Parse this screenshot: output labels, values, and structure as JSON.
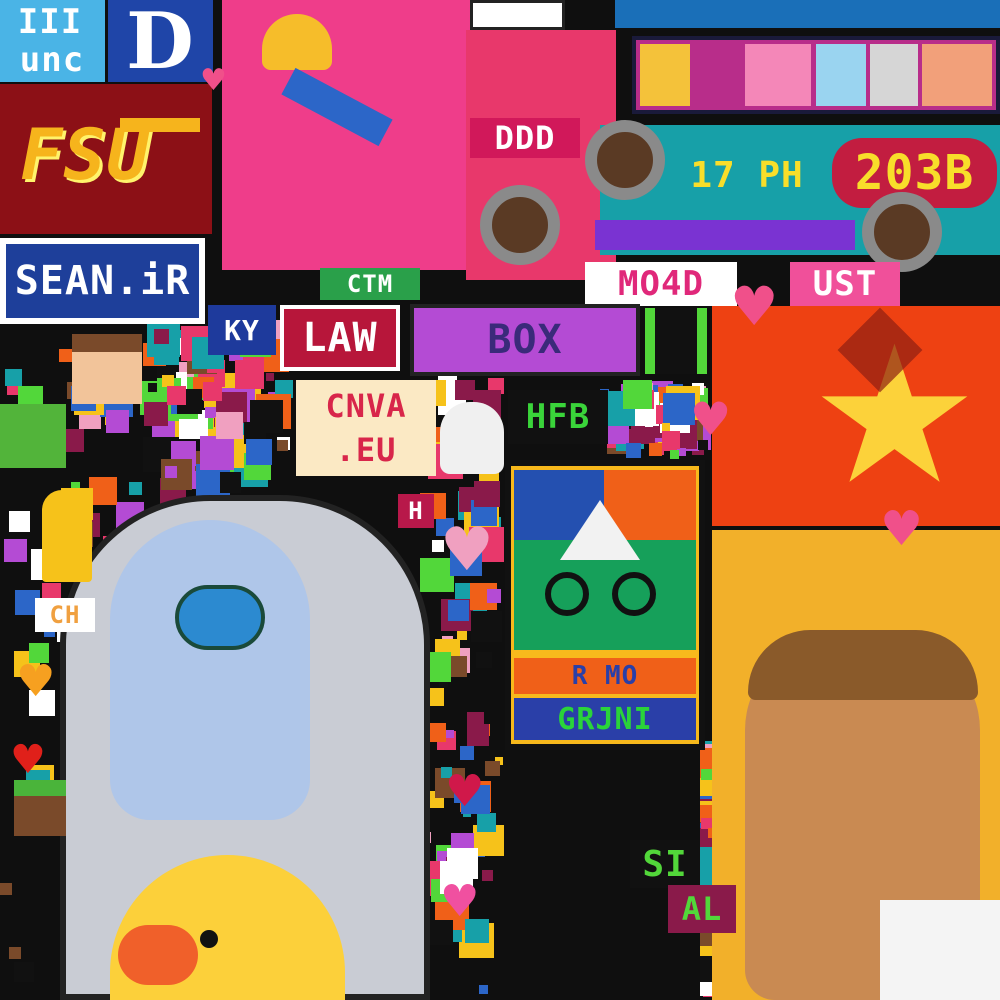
{
  "labels": {
    "unc": "unc",
    "d": "D",
    "fsu": "FSU",
    "sean": "SEAN.iR",
    "law": "LAW",
    "cnva": "CNVA",
    "eu": ".EU",
    "hfb": "HFB",
    "ddd": "DDD",
    "ph": "17 PH",
    "num": "203B",
    "mopo": "MO4D",
    "ust": "UST",
    "ctm": "CTM",
    "ky": "KY",
    "box": "BOX",
    "ch": "CH",
    "h": "H",
    "rmo": "R MO",
    "grjni": "GRJNI",
    "si": "SI",
    "al": "AL",
    "iii": "III"
  },
  "colors": {
    "uncBlue": "#4a9ee0",
    "dukeBlue": "#1d3f9e",
    "fsuRed": "#8a0f14",
    "fsuGold": "#f4b21c",
    "pink": "#f0368a",
    "vietRed": "#ee3a12",
    "vietStar": "#fcd23a",
    "greenMountain": "#16a05a",
    "grey": "#c4c8d0",
    "duck": "#fcd03a"
  }
}
